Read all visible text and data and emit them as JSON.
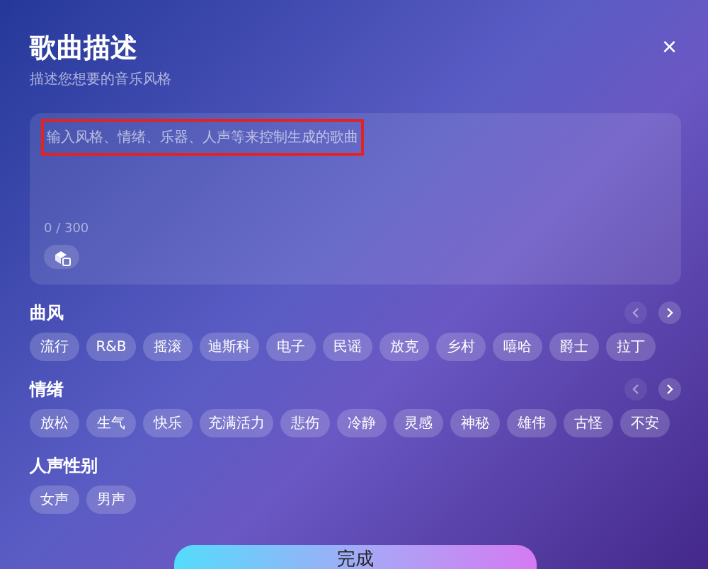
{
  "dialog": {
    "title": "歌曲描述",
    "subtitle": "描述您想要的音乐风格",
    "close_icon": "×"
  },
  "description_field": {
    "placeholder": "输入风格、情绪、乐器、人声等来控制生成的歌曲",
    "placeholder_highlighted": true,
    "counter": "0 / 300"
  },
  "sections": [
    {
      "title": "曲风",
      "arrows": true,
      "tags": [
        "流行",
        "R&B",
        "摇滚",
        "迪斯科",
        "电子",
        "民谣",
        "放克",
        "乡村",
        "嘻哈",
        "爵士",
        "拉丁"
      ]
    },
    {
      "title": "情绪",
      "arrows": true,
      "tags": [
        "放松",
        "生气",
        "快乐",
        "充满活力",
        "悲伤",
        "冷静",
        "灵感",
        "神秘",
        "雄伟",
        "古怪",
        "不安"
      ]
    },
    {
      "title": "人声性别",
      "arrows": false,
      "tags": [
        "女声",
        "男声"
      ]
    }
  ],
  "done_button": {
    "label": "完成"
  }
}
